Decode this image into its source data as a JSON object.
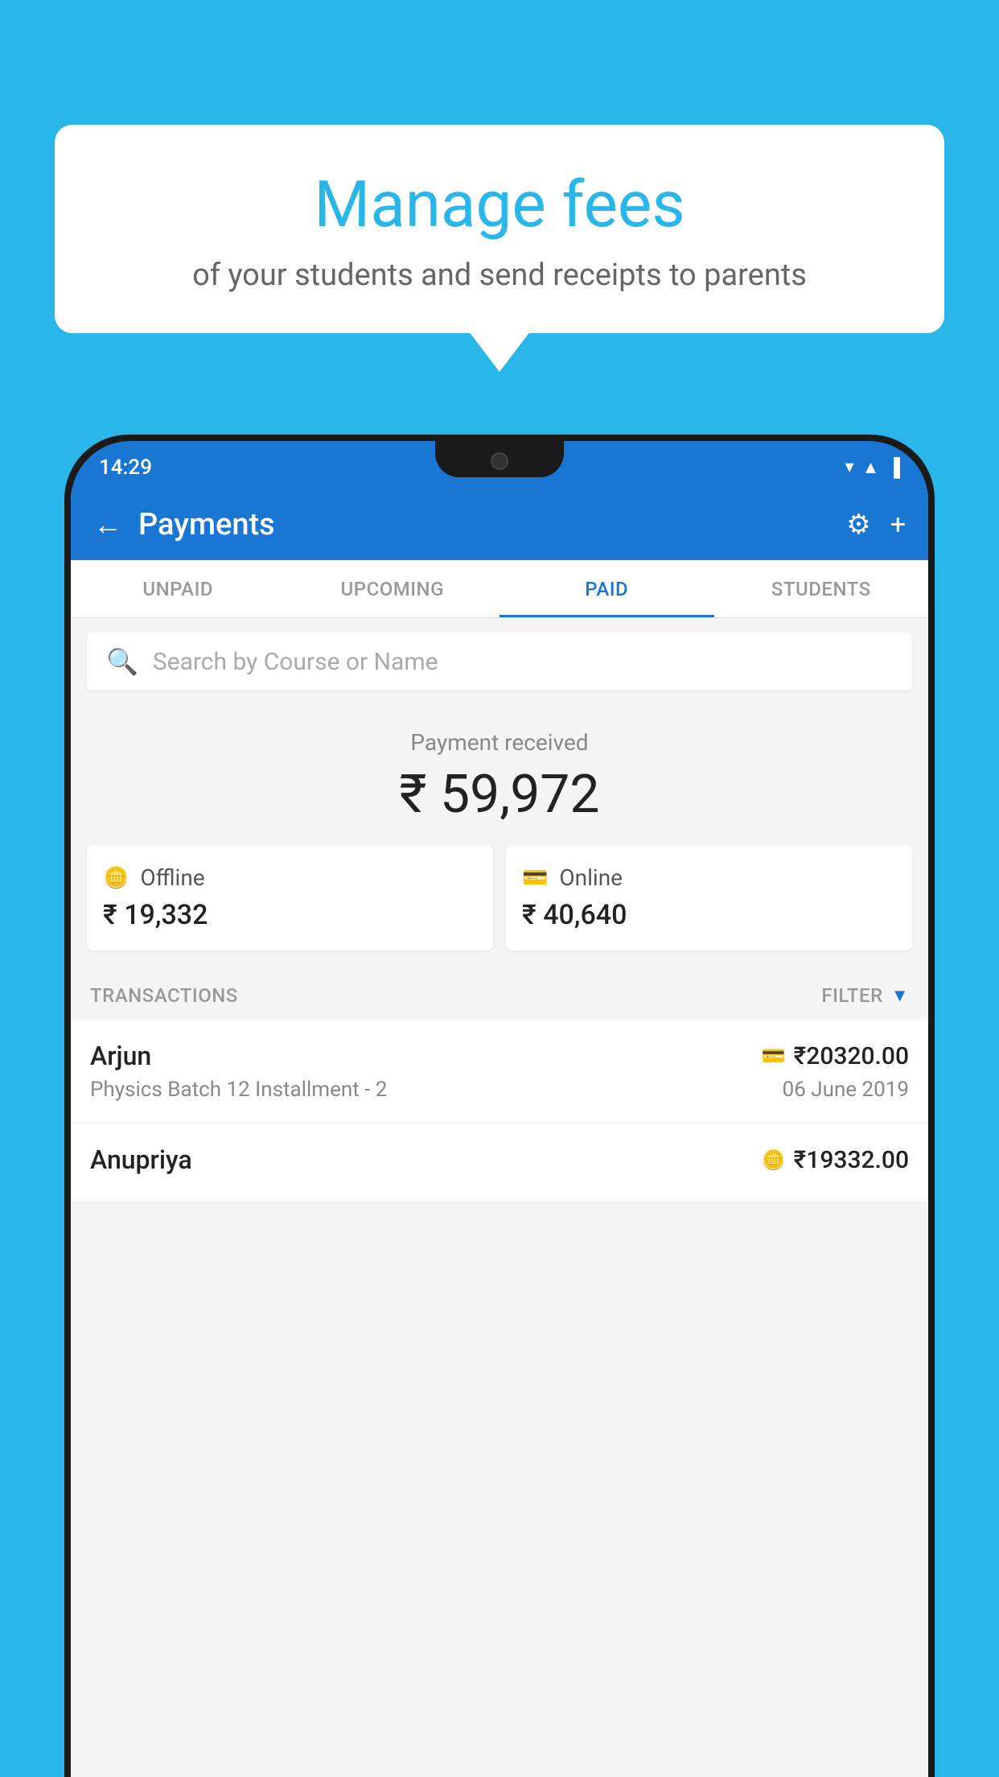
{
  "background_color": "#29B6E8",
  "bubble": {
    "title": "Manage fees",
    "subtitle": "of your students and send receipts to parents"
  },
  "status_bar": {
    "time": "14:29",
    "wifi": "▼",
    "signal": "▲",
    "battery": "▐"
  },
  "header": {
    "title": "Payments",
    "back_label": "←",
    "settings_label": "⚙",
    "add_label": "+"
  },
  "tabs": [
    {
      "label": "UNPAID",
      "active": false
    },
    {
      "label": "UPCOMING",
      "active": false
    },
    {
      "label": "PAID",
      "active": true
    },
    {
      "label": "STUDENTS",
      "active": false
    }
  ],
  "search": {
    "placeholder": "Search by Course or Name"
  },
  "payment_summary": {
    "label": "Payment received",
    "amount": "₹ 59,972",
    "offline": {
      "type": "Offline",
      "amount": "₹ 19,332"
    },
    "online": {
      "type": "Online",
      "amount": "₹ 40,640"
    }
  },
  "transactions_section": {
    "label": "TRANSACTIONS",
    "filter_label": "FILTER"
  },
  "transactions": [
    {
      "name": "Arjun",
      "course": "Physics Batch 12 Installment - 2",
      "amount": "₹20320.00",
      "date": "06 June 2019",
      "type": "online"
    },
    {
      "name": "Anupriya",
      "course": "",
      "amount": "₹19332.00",
      "date": "",
      "type": "offline"
    }
  ]
}
